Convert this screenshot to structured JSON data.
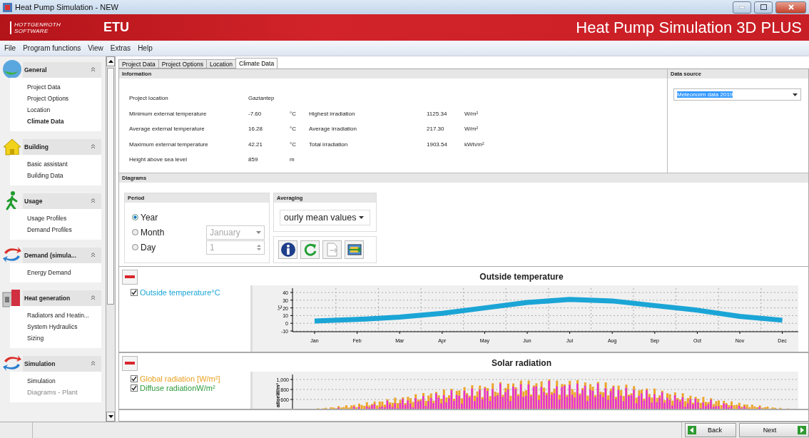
{
  "window": {
    "title": "Heat Pump Simulation - NEW"
  },
  "banner": {
    "logo_lines": [
      "HOTTGENROTH",
      "SOFTWARE"
    ],
    "brand": "ETU",
    "product": "Heat Pump Simulation 3D PLUS"
  },
  "menu": [
    "File",
    "Program functions",
    "View",
    "Extras",
    "Help"
  ],
  "sidebar": {
    "sections": [
      {
        "title": "General",
        "kind": "globe",
        "expanded": true,
        "items": [
          {
            "label": "Project Data",
            "selected": false,
            "disabled": false
          },
          {
            "label": "Project Options",
            "selected": false,
            "disabled": false
          },
          {
            "label": "Location",
            "selected": false,
            "disabled": false
          },
          {
            "label": "Climate Data",
            "selected": true,
            "disabled": false
          }
        ]
      },
      {
        "title": "Building",
        "kind": "house",
        "expanded": true,
        "items": [
          {
            "label": "Basic assistant",
            "selected": false,
            "disabled": false
          },
          {
            "label": "Building Data",
            "selected": false,
            "disabled": false
          }
        ]
      },
      {
        "title": "Usage",
        "kind": "walker",
        "expanded": true,
        "items": [
          {
            "label": "Usage Profiles",
            "selected": false,
            "disabled": false
          },
          {
            "label": "Demand Profiles",
            "selected": false,
            "disabled": false
          }
        ]
      },
      {
        "title": "Demand (simula...",
        "kind": "cycle",
        "expanded": true,
        "items": [
          {
            "label": "Energy Demand",
            "selected": false,
            "disabled": false
          }
        ]
      },
      {
        "title": "Heat generation",
        "kind": "heater",
        "expanded": true,
        "items": [
          {
            "label": "Radiators and Heatin...",
            "selected": false,
            "disabled": false
          },
          {
            "label": "System Hydraulics",
            "selected": false,
            "disabled": false
          },
          {
            "label": "Sizing",
            "selected": false,
            "disabled": false
          }
        ]
      },
      {
        "title": "Simulation",
        "kind": "cycle",
        "expanded": true,
        "items": [
          {
            "label": "Simulation",
            "selected": false,
            "disabled": false
          },
          {
            "label": "Diagrams - Plant",
            "selected": false,
            "disabled": true
          }
        ]
      }
    ]
  },
  "tabs": [
    {
      "label": "Project Data",
      "selected": false
    },
    {
      "label": "Project Options",
      "selected": false
    },
    {
      "label": "Location",
      "selected": false
    },
    {
      "label": "Climate Data",
      "selected": true
    }
  ],
  "information": {
    "title": "Information",
    "rows": [
      {
        "label": "Project location",
        "value": "Gaziantep"
      },
      {
        "label": "Minimum external temperature",
        "value": "-7.60",
        "unit": "°C",
        "label2": "Highest irradiation",
        "value2": "1125.34",
        "unit2": "W/m²"
      },
      {
        "label": "Average external temperature",
        "value": "16.28",
        "unit": "°C",
        "label2": "Average irradiation",
        "value2": "217.30",
        "unit2": "W/m²"
      },
      {
        "label": "Maximum external temperature",
        "value": "42.21",
        "unit": "°C",
        "label2": "Total irradiation",
        "value2": "1903.54",
        "unit2": "kWh/m²"
      },
      {
        "label": "Height above sea level",
        "value": "859",
        "unit": "m"
      }
    ]
  },
  "data_source": {
    "title": "Data source",
    "value": "Meteonorm data 2019"
  },
  "diagrams": {
    "title": "Diagrams",
    "period": {
      "title": "Period",
      "options": [
        {
          "label": "Year",
          "selected": true
        },
        {
          "label": "Month",
          "selected": false
        },
        {
          "label": "Day",
          "selected": false
        }
      ],
      "month": {
        "value": "January",
        "disabled": true
      },
      "day": {
        "value": "1",
        "disabled": true
      }
    },
    "averaging": {
      "title": "Averaging",
      "value": "ourly mean values"
    },
    "charts": [
      {
        "title": "Outside temperature",
        "legend": [
          {
            "checked": true
          }
        ],
        "chart_data": {
          "type": "line",
          "ylabel": "°C",
          "categories": [
            "Jan",
            "Feb",
            "Mar",
            "Apr",
            "May",
            "Jun",
            "Jul",
            "Aug",
            "Sep",
            "Oct",
            "Nov",
            "Dec"
          ],
          "series": [
            {
              "name": "Outside temperature°C",
              "color": "#1aa5d6",
              "values": [
                3,
                5,
                8,
                13,
                20,
                27,
                31,
                29,
                23,
                17,
                9,
                4
              ]
            }
          ],
          "ylim": [
            -10,
            45
          ],
          "yticks": [
            -10,
            0,
            10,
            20,
            30,
            40
          ],
          "grid": true
        }
      },
      {
        "title": "Solar radiation",
        "legend": [
          {
            "label": "Global radiation [W/m²]",
            "checked": true,
            "color": "#e8a020"
          },
          {
            "label": "Diffuse radiationW/m²",
            "checked": true,
            "color": "#2e9a3a"
          }
        ],
        "axis": {
          "ylabel": "ationW/m²",
          "yticks": [
            "1,000",
            "800",
            "600"
          ]
        }
      }
    ]
  },
  "status_bar": {
    "buttons": [
      {
        "label": "Back",
        "kind": "back"
      },
      {
        "label": "Next",
        "kind": "next"
      }
    ]
  }
}
